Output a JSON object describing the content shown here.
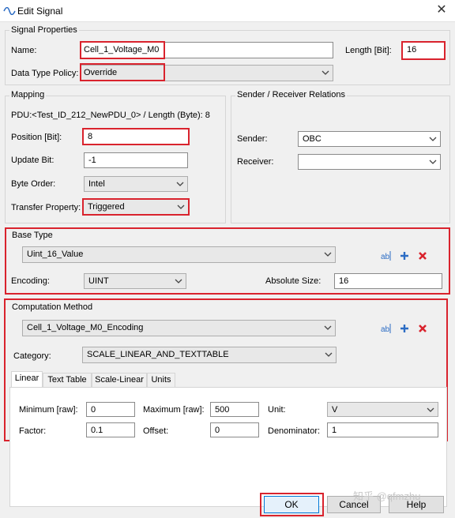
{
  "window": {
    "title": "Edit Signal",
    "close_glyph": "✕"
  },
  "signal_properties": {
    "group_label": "Signal Properties",
    "name_label": "Name:",
    "name_value": "Cell_1_Voltage_M0",
    "length_label": "Length [Bit]:",
    "length_value": "16",
    "policy_label": "Data Type Policy:",
    "policy_value": "Override"
  },
  "mapping": {
    "group_label": "Mapping",
    "pdu_text": "PDU:<Test_ID_212_NewPDU_0> / Length (Byte): 8",
    "position_label": "Position [Bit]:",
    "position_value": "8",
    "update_bit_label": "Update Bit:",
    "update_bit_value": "-1",
    "byte_order_label": "Byte Order:",
    "byte_order_value": "Intel",
    "transfer_label": "Transfer Property:",
    "transfer_value": "Triggered"
  },
  "sender_receiver": {
    "group_label": "Sender / Receiver Relations",
    "sender_label": "Sender:",
    "sender_value": "OBC",
    "receiver_label": "Receiver:",
    "receiver_value": ""
  },
  "base_type": {
    "group_label": "Base Type",
    "type_value": "Uint_16_Value",
    "encoding_label": "Encoding:",
    "encoding_value": "UINT",
    "abs_size_label": "Absolute Size:",
    "abs_size_value": "16"
  },
  "computation": {
    "group_label": "Computation Method",
    "method_value": "Cell_1_Voltage_M0_Encoding",
    "category_label": "Category:",
    "category_value": "SCALE_LINEAR_AND_TEXTTABLE",
    "tabs": [
      "Linear",
      "Text Table",
      "Scale-Linear",
      "Units"
    ],
    "linear": {
      "min_label": "Minimum [raw]:",
      "min_value": "0",
      "max_label": "Maximum [raw]:",
      "max_value": "500",
      "unit_label": "Unit:",
      "unit_value": "V",
      "factor_label": "Factor:",
      "factor_value": "0.1",
      "offset_label": "Offset:",
      "offset_value": "0",
      "denominator_label": "Denominator:",
      "denominator_value": "1"
    }
  },
  "buttons": {
    "ok": "OK",
    "cancel": "Cancel",
    "help": "Help"
  },
  "watermark": "知乎 @qfmzhu",
  "colors": {
    "highlight": "#d9232d",
    "icon_blue": "#2b6cc4",
    "icon_red": "#d9232d"
  }
}
